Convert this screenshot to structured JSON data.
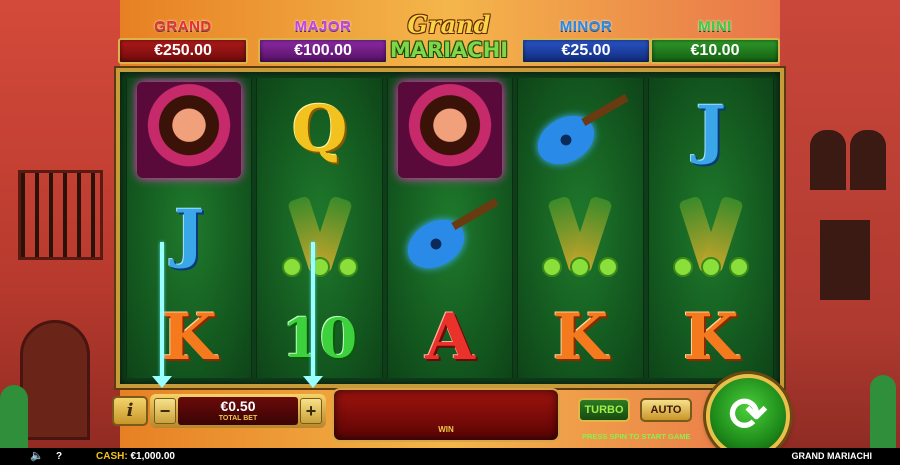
{
  "jackpots": [
    {
      "name": "GRAND",
      "value": "€250.00",
      "color": "#e8322a"
    },
    {
      "name": "MAJOR",
      "value": "€100.00",
      "color": "#c642e8"
    },
    {
      "name": "MINOR",
      "value": "€25.00",
      "color": "#2a8ae8"
    },
    {
      "name": "MINI",
      "value": "€10.00",
      "color": "#3ed13e"
    }
  ],
  "logo": {
    "line1": "Grand",
    "line2": "MARIACHI"
  },
  "reels": [
    [
      "woman-portrait",
      "J",
      "K"
    ],
    [
      "Q",
      "bottles",
      "10"
    ],
    [
      "woman-portrait",
      "guitar",
      "A"
    ],
    [
      "guitar",
      "bottles",
      "K"
    ],
    [
      "J",
      "bottles",
      "K"
    ]
  ],
  "controls": {
    "info_label": "i",
    "bet_minus": "−",
    "bet_plus": "+",
    "bet_value": "€0.50",
    "bet_label": "TOTAL BET",
    "win_label": "WIN",
    "turbo_label": "TURBO",
    "auto_label": "AUTO",
    "press_spin": "PRESS SPIN TO START GAME",
    "spin_symbol": "⟳"
  },
  "statusbar": {
    "sound_icon": "🔈",
    "help_label": "?",
    "cash_label": "CASH:",
    "cash_value": "€1,000.00",
    "game_name": "GRAND MARIACHI"
  }
}
